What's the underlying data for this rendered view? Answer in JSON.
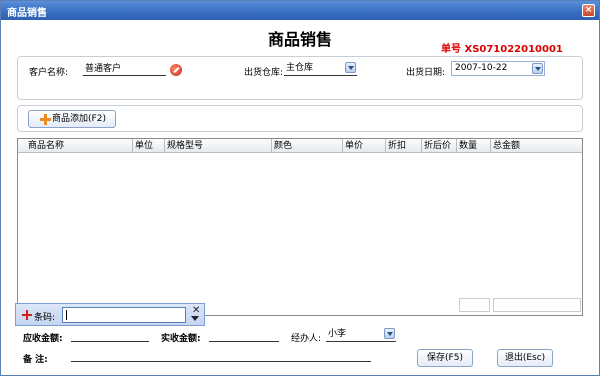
{
  "window": {
    "title": "商品销售",
    "close_label": "×"
  },
  "header": {
    "title": "商品销售",
    "doc_no": "单号  XS071022010001"
  },
  "form": {
    "customer_label": "客户名称:",
    "customer_value": "普通客户",
    "warehouse_label": "出货仓库:",
    "warehouse_value": "主仓库",
    "date_label": "出货日期:",
    "date_value": "2007-10-22"
  },
  "toolbar": {
    "add_label": "商品添加(F2)"
  },
  "grid": {
    "columns": [
      "商品名称",
      "单位",
      "规格型号",
      "颜色",
      "单价",
      "折扣",
      "折后价",
      "数量",
      "总金额"
    ]
  },
  "barcode": {
    "label": "条码:"
  },
  "footer": {
    "receivable_label": "应收金额:",
    "received_label": "实收金额:",
    "handler_label": "经办人:",
    "handler_value": "小李",
    "remark_label": "备    注:",
    "save_label": "保存(F5)",
    "exit_label": "退出(Esc)"
  }
}
